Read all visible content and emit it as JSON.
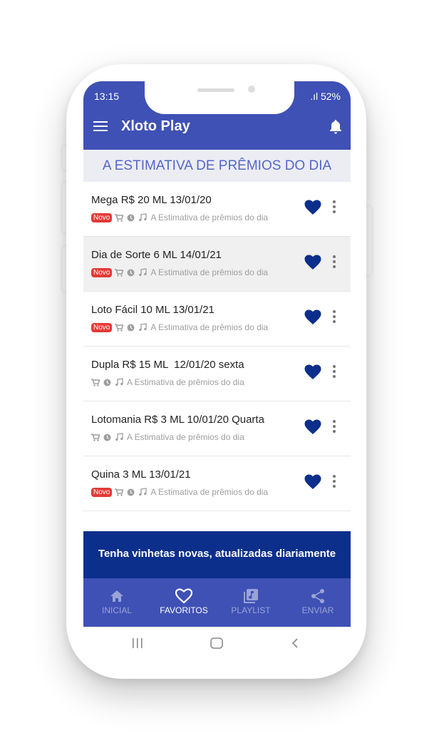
{
  "status": {
    "time": "13:15",
    "signal": ".ıl 52%"
  },
  "app": {
    "title": "Xloto Play"
  },
  "section": {
    "title": "A ESTIMATIVA DE PRÊMIOS DO DIA"
  },
  "items": [
    {
      "title": "Mega R$ 20 ML 13/01/20",
      "badge": "Novo",
      "subtitle": "A Estimativa de prêmios do dia"
    },
    {
      "title": "Dia de Sorte 6 ML 14/01/21",
      "badge": "Novo",
      "subtitle": "A Estimativa de prêmios do dia"
    },
    {
      "title": "Loto Fácil 10 ML 13/01/21",
      "badge": "Novo",
      "subtitle": "A Estimativa de prêmios do dia"
    },
    {
      "title": "Dupla R$ 15 ML  12/01/20 sexta",
      "badge": "",
      "subtitle": "A Estimativa de prêmios do dia"
    },
    {
      "title": "Lotomania R$ 3 ML 10/01/20 Quarta",
      "badge": "",
      "subtitle": "A Estimativa de prêmios do dia"
    },
    {
      "title": "Quina 3 ML 13/01/21",
      "badge": "Novo",
      "subtitle": "A Estimativa de prêmios do dia"
    }
  ],
  "banner": {
    "text": "Tenha vinhetas novas, atualizadas diariamente"
  },
  "nav": [
    {
      "label": "INICIAL",
      "icon": "home-icon",
      "active": false
    },
    {
      "label": "FAVORITOS",
      "icon": "heart-outline-icon",
      "active": true
    },
    {
      "label": "PLAYLIST",
      "icon": "playlist-icon",
      "active": false
    },
    {
      "label": "ENVIAR",
      "icon": "share-icon",
      "active": false
    }
  ],
  "colors": {
    "primary": "#3f51b5",
    "banner": "#0d2f8c",
    "accent": "#5466c9",
    "heart": "#0d2f8c",
    "badge": "#e53935"
  }
}
